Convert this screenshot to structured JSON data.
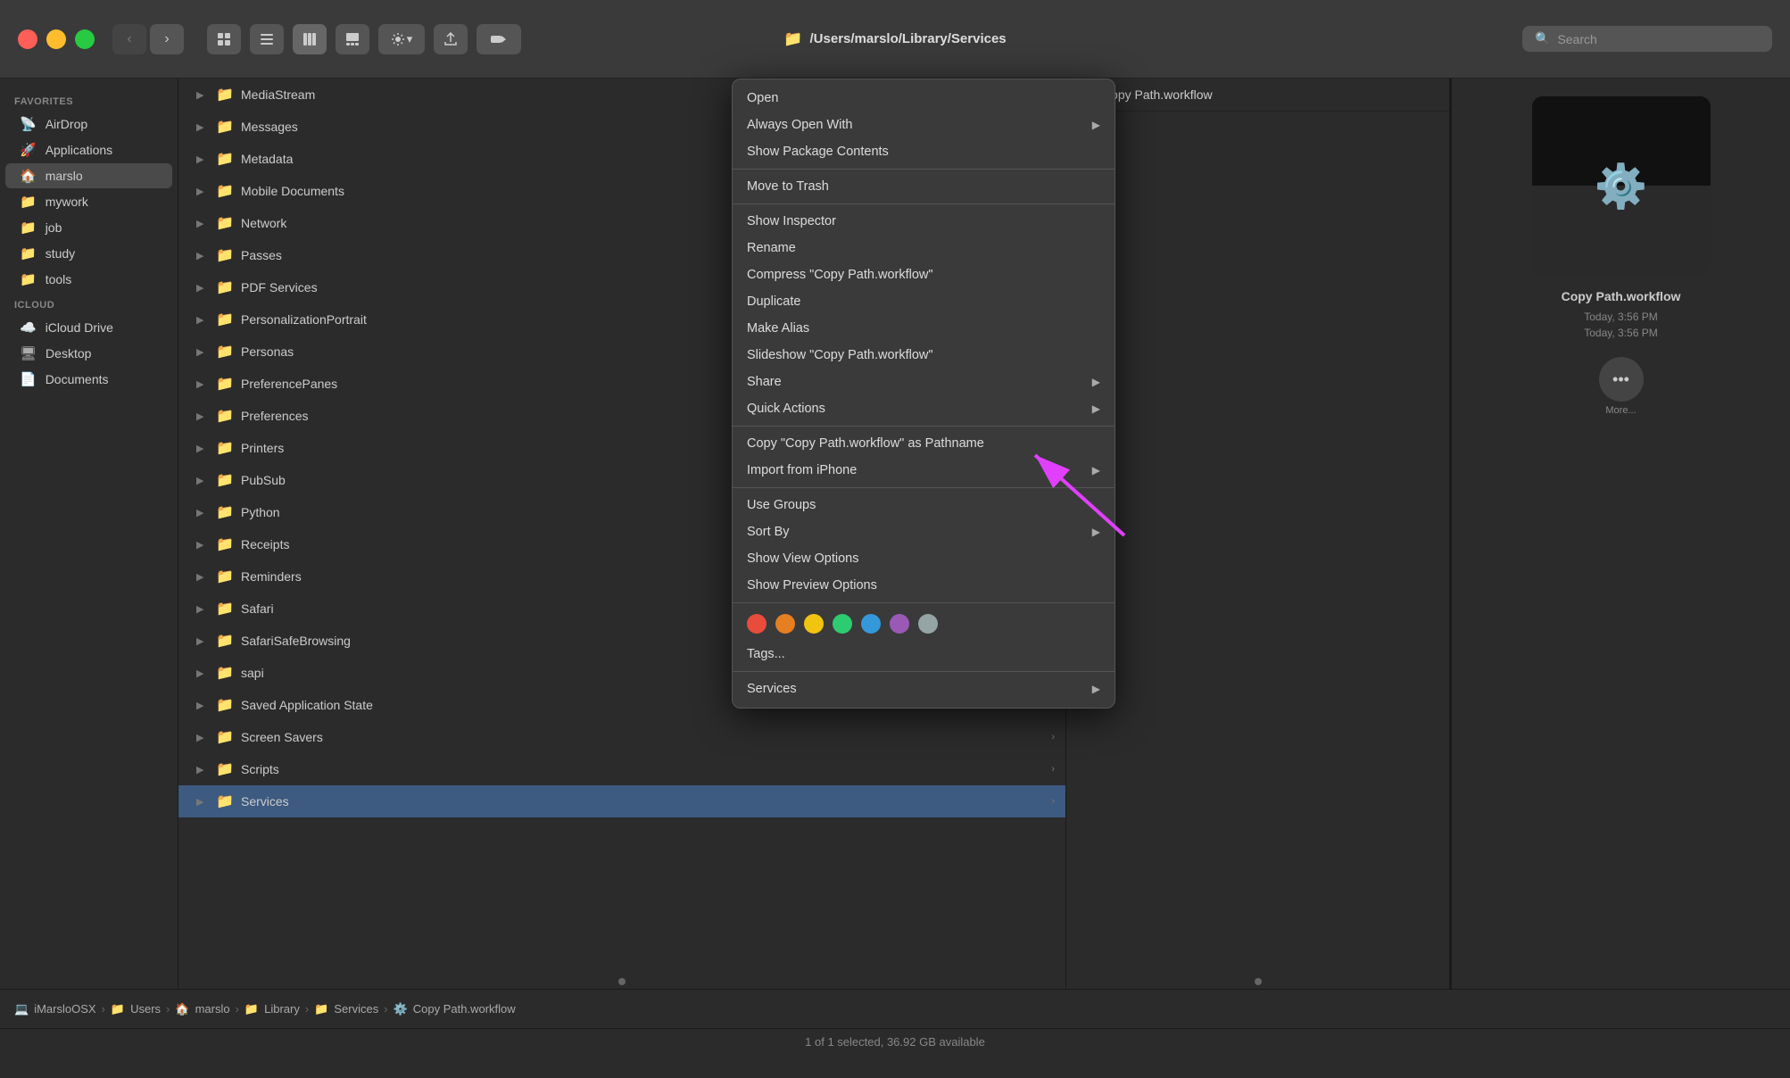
{
  "window": {
    "title": "/Users/marslo/Library/Services"
  },
  "titlebar": {
    "path": "/Users/marslo/Library/Services"
  },
  "search": {
    "placeholder": "Search"
  },
  "sidebar": {
    "sections": [
      {
        "label": "Favorites",
        "items": [
          {
            "id": "airdrop",
            "label": "AirDrop",
            "icon": "📡"
          },
          {
            "id": "applications",
            "label": "Applications",
            "icon": "🚀"
          },
          {
            "id": "marslo",
            "label": "marslo",
            "icon": "🏠",
            "active": true
          },
          {
            "id": "mywork",
            "label": "mywork",
            "icon": "📁"
          },
          {
            "id": "job",
            "label": "job",
            "icon": "📁"
          },
          {
            "id": "study",
            "label": "study",
            "icon": "📁"
          },
          {
            "id": "tools",
            "label": "tools",
            "icon": "📁"
          }
        ]
      },
      {
        "label": "iCloud",
        "items": [
          {
            "id": "icloud-drive",
            "label": "iCloud Drive",
            "icon": "☁️"
          },
          {
            "id": "desktop",
            "label": "Desktop",
            "icon": "📄"
          },
          {
            "id": "documents",
            "label": "Documents",
            "icon": "📄"
          }
        ]
      }
    ]
  },
  "files": [
    {
      "name": "MediaStream",
      "hasArrow": true
    },
    {
      "name": "Messages",
      "hasArrow": true
    },
    {
      "name": "Metadata",
      "hasArrow": true
    },
    {
      "name": "Mobile Documents",
      "hasArrow": true
    },
    {
      "name": "Network",
      "hasArrow": true
    },
    {
      "name": "Passes",
      "hasArrow": true
    },
    {
      "name": "PDF Services",
      "hasArrow": true
    },
    {
      "name": "PersonalizationPortrait",
      "hasArrow": true
    },
    {
      "name": "Personas",
      "hasArrow": true
    },
    {
      "name": "PreferencePanes",
      "hasArrow": true
    },
    {
      "name": "Preferences",
      "hasArrow": true
    },
    {
      "name": "Printers",
      "hasArrow": true
    },
    {
      "name": "PubSub",
      "hasArrow": true
    },
    {
      "name": "Python",
      "hasArrow": true
    },
    {
      "name": "Receipts",
      "hasArrow": true
    },
    {
      "name": "Reminders",
      "hasArrow": true
    },
    {
      "name": "Safari",
      "hasArrow": true
    },
    {
      "name": "SafariSafeBrowsing",
      "hasArrow": true
    },
    {
      "name": "sapi",
      "hasArrow": true
    },
    {
      "name": "Saved Application State",
      "hasArrow": true
    },
    {
      "name": "Screen Savers",
      "hasArrow": true
    },
    {
      "name": "Scripts",
      "hasArrow": true
    },
    {
      "name": "Services",
      "hasArrow": true,
      "selected": true
    }
  ],
  "context_menu": {
    "items": [
      {
        "id": "open",
        "label": "Open",
        "hasArrow": false,
        "separator_after": false
      },
      {
        "id": "always-open-with",
        "label": "Always Open With",
        "hasArrow": true,
        "separator_after": false
      },
      {
        "id": "show-package-contents",
        "label": "Show Package Contents",
        "hasArrow": false,
        "separator_after": true
      },
      {
        "id": "move-to-trash",
        "label": "Move to Trash",
        "hasArrow": false,
        "separator_after": true
      },
      {
        "id": "show-inspector",
        "label": "Show Inspector",
        "hasArrow": false,
        "separator_after": false
      },
      {
        "id": "rename",
        "label": "Rename",
        "hasArrow": false,
        "separator_after": false
      },
      {
        "id": "compress",
        "label": "Compress \"Copy Path.workflow\"",
        "hasArrow": false,
        "separator_after": false
      },
      {
        "id": "duplicate",
        "label": "Duplicate",
        "hasArrow": false,
        "separator_after": false
      },
      {
        "id": "make-alias",
        "label": "Make Alias",
        "hasArrow": false,
        "separator_after": false
      },
      {
        "id": "slideshow",
        "label": "Slideshow \"Copy Path.workflow\"",
        "hasArrow": false,
        "separator_after": false
      },
      {
        "id": "share",
        "label": "Share",
        "hasArrow": true,
        "separator_after": false
      },
      {
        "id": "quick-actions",
        "label": "Quick Actions",
        "hasArrow": true,
        "separator_after": true
      },
      {
        "id": "copy-pathname",
        "label": "Copy \"Copy Path.workflow\" as Pathname",
        "hasArrow": false,
        "separator_after": false
      },
      {
        "id": "import-iphone",
        "label": "Import from iPhone",
        "hasArrow": true,
        "separator_after": true
      },
      {
        "id": "use-groups",
        "label": "Use Groups",
        "hasArrow": false,
        "separator_after": false
      },
      {
        "id": "sort-by",
        "label": "Sort By",
        "hasArrow": true,
        "separator_after": false
      },
      {
        "id": "show-view-options",
        "label": "Show View Options",
        "hasArrow": false,
        "separator_after": false
      },
      {
        "id": "show-preview-options",
        "label": "Show Preview Options",
        "hasArrow": false,
        "separator_after": true
      },
      {
        "id": "tags",
        "label": "Tags...",
        "hasArrow": false,
        "separator_after": true
      },
      {
        "id": "services",
        "label": "Services",
        "hasArrow": true,
        "separator_after": false
      }
    ],
    "tags": [
      {
        "id": "red",
        "color": "#e74c3c"
      },
      {
        "id": "orange",
        "color": "#e67e22"
      },
      {
        "id": "yellow",
        "color": "#f1c40f"
      },
      {
        "id": "green",
        "color": "#2ecc71"
      },
      {
        "id": "blue",
        "color": "#3498db"
      },
      {
        "id": "purple",
        "color": "#9b59b6"
      },
      {
        "id": "gray",
        "color": "#95a5a6"
      }
    ]
  },
  "col2_header": "Copy Path.workflow",
  "preview": {
    "name": "Copy Path.workflow",
    "detail1": "Today, 3:56 PM",
    "detail2": "Today, 3:56 PM",
    "more_label": "More..."
  },
  "breadcrumb": {
    "items": [
      {
        "label": "iMarsloOSX",
        "icon": "💻"
      },
      {
        "label": "Users",
        "icon": "📁"
      },
      {
        "label": "marslo",
        "icon": "🏠"
      },
      {
        "label": "Library",
        "icon": "📁"
      },
      {
        "label": "Services",
        "icon": "📁"
      },
      {
        "label": "Copy Path.workflow",
        "icon": "⚙️"
      }
    ]
  },
  "statusbar": {
    "text": "1 of 1 selected, 36.92 GB available"
  }
}
